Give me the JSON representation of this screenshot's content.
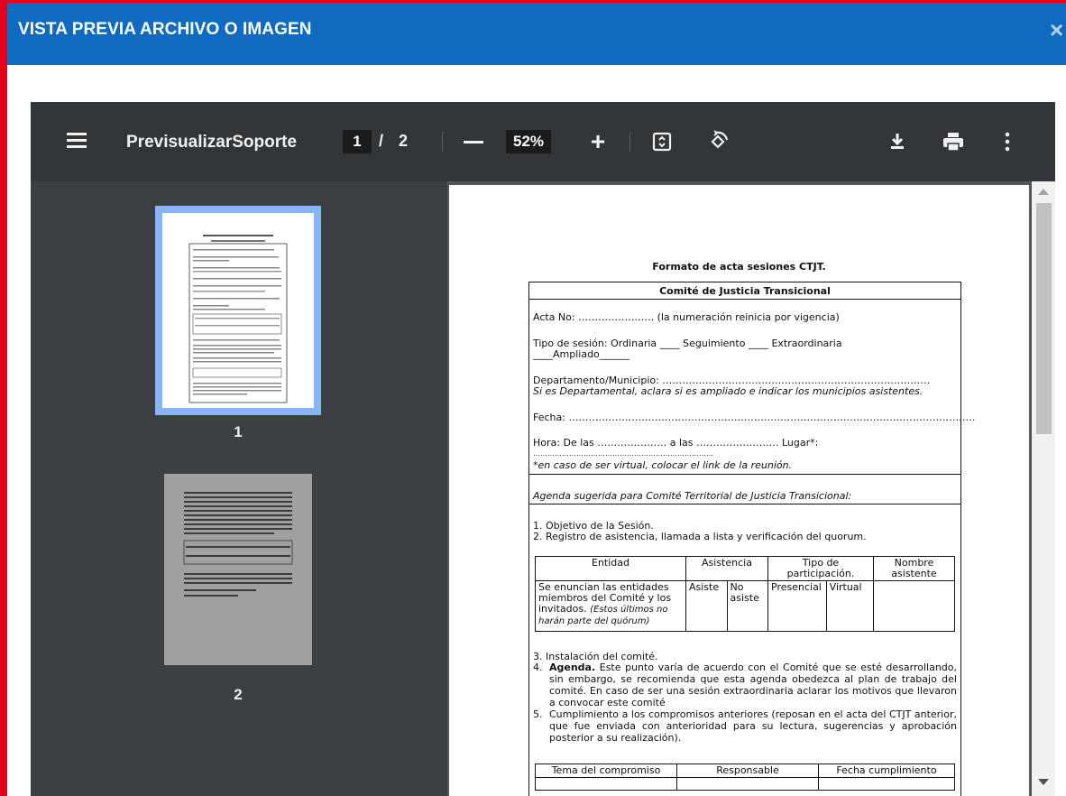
{
  "dialog": {
    "title": "VISTA PREVIA ARCHIVO O IMAGEN",
    "close_label": "×"
  },
  "toolbar": {
    "doc_title": "PrevisualizarSoporte",
    "current_page": "1",
    "page_separator": "/",
    "total_pages": "2",
    "zoom": "52%",
    "zoom_in": "+"
  },
  "thumbnails": [
    {
      "label": "1"
    },
    {
      "label": "2"
    }
  ],
  "document": {
    "heading": "Formato de acta sesiones CTJT.",
    "committee": "Comité de Justicia Transicional",
    "acta_no": "Acta No: ………………….. (la numeración reinicia por vigencia)",
    "tipo_line1": "Tipo de sesión: Ordinaria ____ Seguimiento ____ Extraordinaria",
    "tipo_line2": "____Ampliado______",
    "departamento": "Departamento/Municipio: ………………………………………………………………………",
    "departamento_note": "Si es Departamental, aclara si es ampliado e indicar los municipios asistentes.",
    "fecha": "Fecha: ……………………………………………………………………………………………………………",
    "hora": "Hora:   De   las   …………………   a   las   ………………….…   Lugar*:",
    "hora_dots": "…………………………………………………………………",
    "virtual_note": "*en caso de ser virtual, colocar el link de la reunión.",
    "agenda_title": "Agenda sugerida para Comité Territorial de Justicia Transicional:",
    "item1": "1. Objetivo de la Sesión.",
    "item2": "2. Registro de asistencia, llamada a lista y verificación del quorum.",
    "table_headers": [
      "Entidad",
      "Asistencia",
      "Tipo de participación.",
      "Nombre asistente"
    ],
    "table_row_entidad": "Se enuncian las entidades miembros del Comité y los invitados.",
    "table_row_entidad_note": "(Estos últimos no harán parte del quórum)",
    "table_row_asiste": "Asiste",
    "table_row_no_asiste": "No asiste",
    "table_row_presencial": "Presencial",
    "table_row_virtual": "Virtual",
    "item3": "3. Instalación del comité.",
    "item4_label": "Agenda.",
    "item4_text": "Este punto varía de acuerdo con el Comité que se esté desarrollando, sin embargo, se recomienda que esta agenda obedezca al plan de trabajo del comité. En caso de ser una sesión extraordinaria aclarar los motivos que llevaron a convocar este comité",
    "item5": "Cumplimiento a los compromisos anteriores (reposan en el acta del CTJT anterior, que fue enviada con anterioridad para su lectura, sugerencias y aprobación posterior a su realización).",
    "comp_headers": [
      "Tema del compromiso",
      "Responsable",
      "Fecha cumplimiento"
    ]
  },
  "colors": {
    "header_blue": "#0e6bbf",
    "frame_red": "#e2001a",
    "toolbar_dark": "#323639",
    "sidebar": "#3c4043",
    "thumb_selected": "#8ab4f8"
  }
}
